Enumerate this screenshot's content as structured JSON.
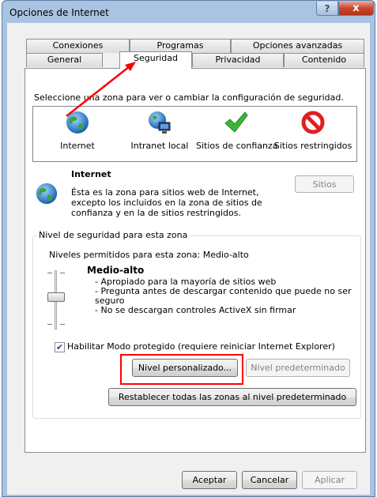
{
  "window": {
    "title": "Opciones de Internet",
    "help": "?",
    "close": "x"
  },
  "tabs": {
    "row1": [
      "Conexiones",
      "Programas",
      "Opciones avanzadas"
    ],
    "row2": [
      "General",
      "Seguridad",
      "Privacidad",
      "Contenido"
    ],
    "active": "Seguridad"
  },
  "security": {
    "instruction": "Seleccione una zona para ver o cambiar la configuración de seguridad.",
    "zones": [
      {
        "label": "Internet",
        "icon": "globe-icon"
      },
      {
        "label": "Intranet local",
        "icon": "intranet-icon"
      },
      {
        "label": "Sitios de confianza",
        "icon": "checkmark-icon"
      },
      {
        "label": "Sitios restringidos",
        "icon": "restricted-icon"
      }
    ],
    "selected_zone": {
      "name": "Internet",
      "desc_line1": "Ésta es la zona para sitios web de Internet,",
      "desc_line2": "excepto los incluidos en la zona de sitios de",
      "desc_line3": "confianza y en la de sitios restringidos."
    },
    "sites_button": "Sitios",
    "level_group": {
      "legend": "Nivel de seguridad para esta zona",
      "allowed": "Niveles permitidos para esta zona: Medio-alto",
      "level_name": "Medio-alto",
      "bullet1": "- Apropiado para la mayoría de sitios web",
      "bullet2a": "- Pregunta antes de descargar contenido que puede no ser",
      "bullet2b": "seguro",
      "bullet3": "- No se descargan controles ActiveX sin firmar",
      "protected_mode_label": "Habilitar Modo protegido (requiere reiniciar Internet Explorer)",
      "protected_mode_checked": true,
      "custom_level_button": "Nivel personalizado...",
      "default_level_button": "Nivel predeterminado"
    },
    "reset_all_button": "Restablecer todas las zonas al nivel predeterminado"
  },
  "footer": {
    "ok": "Aceptar",
    "cancel": "Cancelar",
    "apply": "Aplicar"
  },
  "colors": {
    "annotation": "#ff0000",
    "title_bar": "#a9c3e2",
    "close_red": "#c9462c"
  }
}
